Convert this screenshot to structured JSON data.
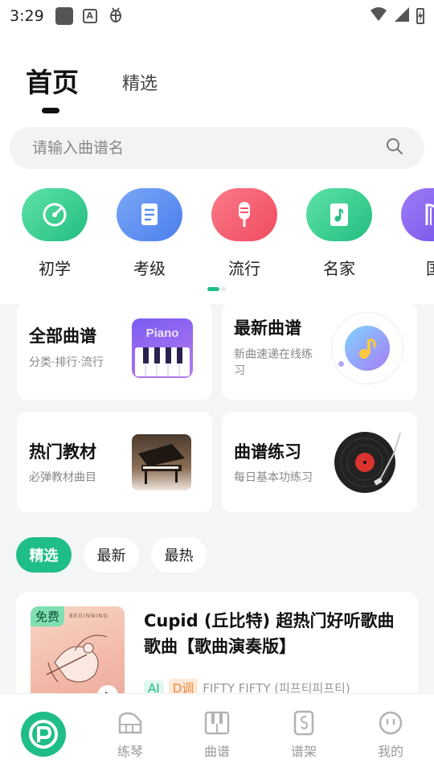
{
  "status": {
    "time": "3:29"
  },
  "tabs": {
    "home": "首页",
    "featured": "精选"
  },
  "search": {
    "placeholder": "请输入曲谱名"
  },
  "categories": [
    {
      "label": "初学",
      "icon": "dial-icon",
      "color": "#33cc8f"
    },
    {
      "label": "考级",
      "icon": "document-icon",
      "color": "#5b8ff2"
    },
    {
      "label": "流行",
      "icon": "microphone-icon",
      "color": "#f2566a"
    },
    {
      "label": "名家",
      "icon": "sheet-music-icon",
      "color": "#35c98b"
    },
    {
      "label": "国",
      "icon": "harp-icon",
      "color": "#8a63f0"
    }
  ],
  "features": {
    "all": {
      "title": "全部曲谱",
      "subtitle": "分类·排行·流行",
      "badge": "Piano"
    },
    "new": {
      "title": "最新曲谱",
      "subtitle": "新曲速递在线练习"
    },
    "textbook": {
      "title": "热门教材",
      "subtitle": "必弹教材曲目"
    },
    "practice": {
      "title": "曲谱练习",
      "subtitle": "每日基本功练习"
    }
  },
  "filters": [
    {
      "label": "精选",
      "active": true
    },
    {
      "label": "最新",
      "active": false
    },
    {
      "label": "最热",
      "active": false
    }
  ],
  "song": {
    "free_tag": "免费",
    "cover_text": "BEGINNING",
    "title": "Cupid (丘比特) 超热门好听歌曲歌曲【歌曲演奏版】",
    "tag_ai": "AI",
    "tag_key": "D调",
    "artist": "FIFTY FIFTY (피프티피프티)"
  },
  "nav": [
    {
      "label": "练琴",
      "icon": "piano-icon"
    },
    {
      "label": "曲谱",
      "icon": "keyboard-icon"
    },
    {
      "label": "谱架",
      "icon": "music-stand-icon"
    },
    {
      "label": "我的",
      "icon": "profile-icon"
    }
  ],
  "colors": {
    "accent": "#1fbe86"
  }
}
